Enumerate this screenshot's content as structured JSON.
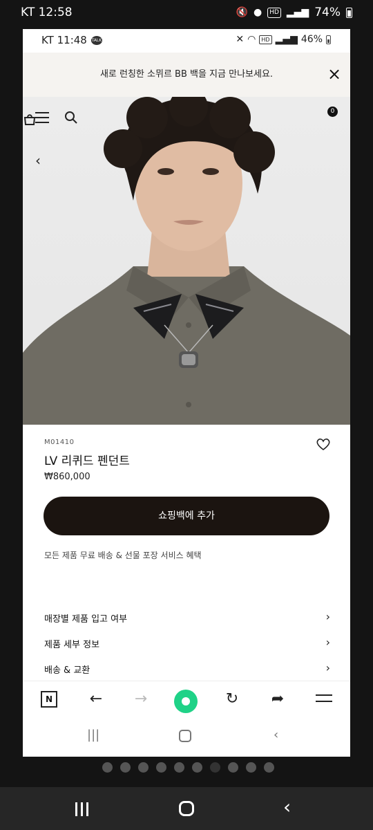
{
  "outer_status": {
    "carrier": "KT 12:58",
    "battery": "74%",
    "hd_label": "HD"
  },
  "inner_status": {
    "carrier": "KT 11:48",
    "talk_badge": "TALK",
    "battery": "46%",
    "hd_label": "HD"
  },
  "promo": {
    "text": "새로 런칭한 소뮈르 BB 백을 지금 만나보세요.",
    "close_glyph": "×"
  },
  "header": {
    "bag_count": "0",
    "back_glyph": "‹"
  },
  "product": {
    "sku": "M01410",
    "title": "LV 리퀴드 펜던트",
    "price": "₩860,000",
    "add_to_bag": "쇼핑백에 추가",
    "perk": "모든 제품 무료 배송 & 선물 포장 서비스 혜택"
  },
  "links": [
    {
      "label": "매장별 제품 입고 여부"
    },
    {
      "label": "제품 세부 정보"
    },
    {
      "label": "배송 & 교환"
    }
  ],
  "browser_bar": {
    "n_label": "N",
    "back": "←",
    "forward": "→",
    "reload": "↻",
    "share": "➦"
  },
  "inner_nav": {
    "recent": "|||",
    "back": "‹"
  },
  "page_dots": {
    "count": 10,
    "active_index": 6
  },
  "colors": {
    "add_button": "#1b1410",
    "naver_green": "#1fd287",
    "promo_bg": "#f5f3f0"
  }
}
